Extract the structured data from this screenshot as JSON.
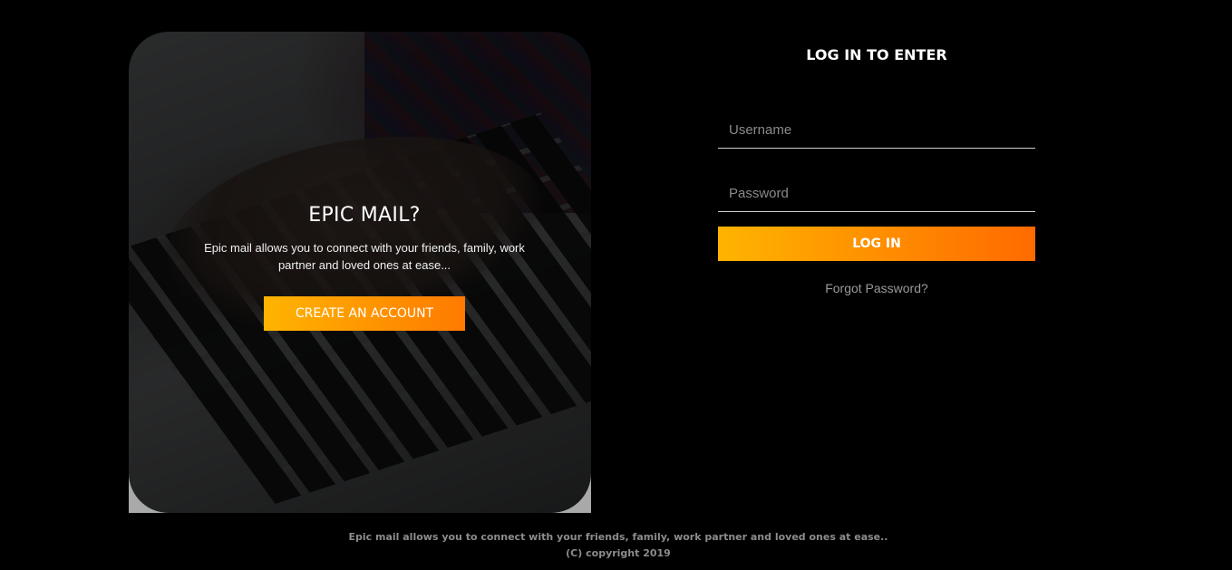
{
  "hero": {
    "title": "EPIC MAIL?",
    "description": "Epic mail allows you to connect with your friends, family, work partner and loved ones at ease...",
    "create_account_label": "CREATE AN ACCOUNT"
  },
  "login": {
    "title": "LOG IN TO ENTER",
    "username": {
      "placeholder": "Username",
      "value": ""
    },
    "password": {
      "placeholder": "Password",
      "value": ""
    },
    "submit_label": "LOG IN",
    "forgot_label": "Forgot Password?"
  },
  "footer": {
    "tagline": "Epic mail allows you to connect with your friends, family, work partner and loved ones at ease..",
    "copyright": "(C) copyright 2019"
  },
  "colors": {
    "background": "#000000",
    "accent_start": "#ffb400",
    "accent_end": "#ff7a00"
  }
}
